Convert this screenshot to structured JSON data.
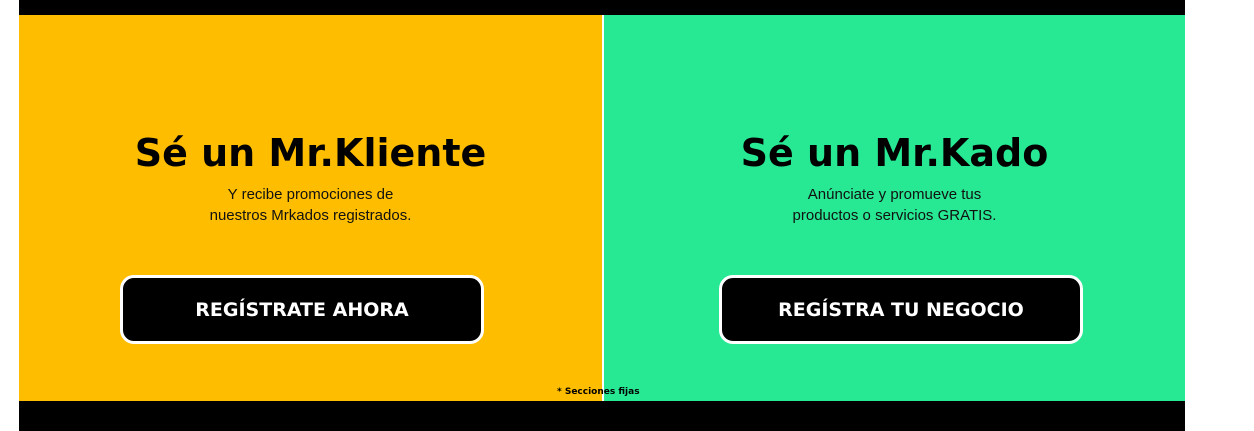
{
  "colors": {
    "left_panel_bg": "#ffbd00",
    "right_panel_bg": "#27e994",
    "button_bg": "#000000",
    "button_text": "#ffffff",
    "frame_bg": "#000000"
  },
  "client_panel": {
    "title": "Sé un Mr.Kliente",
    "subtitle_line1": "Y recibe promociones de",
    "subtitle_line2": "nuestros Mrkados registrados.",
    "button_label": "REGÍSTRATE AHORA"
  },
  "business_panel": {
    "title": "Sé un Mr.Kado",
    "subtitle_line1": "Anúnciate y promueve tus",
    "subtitle_line2": "productos o servicios GRATIS.",
    "button_label": "REGÍSTRA TU NEGOCIO"
  },
  "footnote": "* Secciones fijas"
}
